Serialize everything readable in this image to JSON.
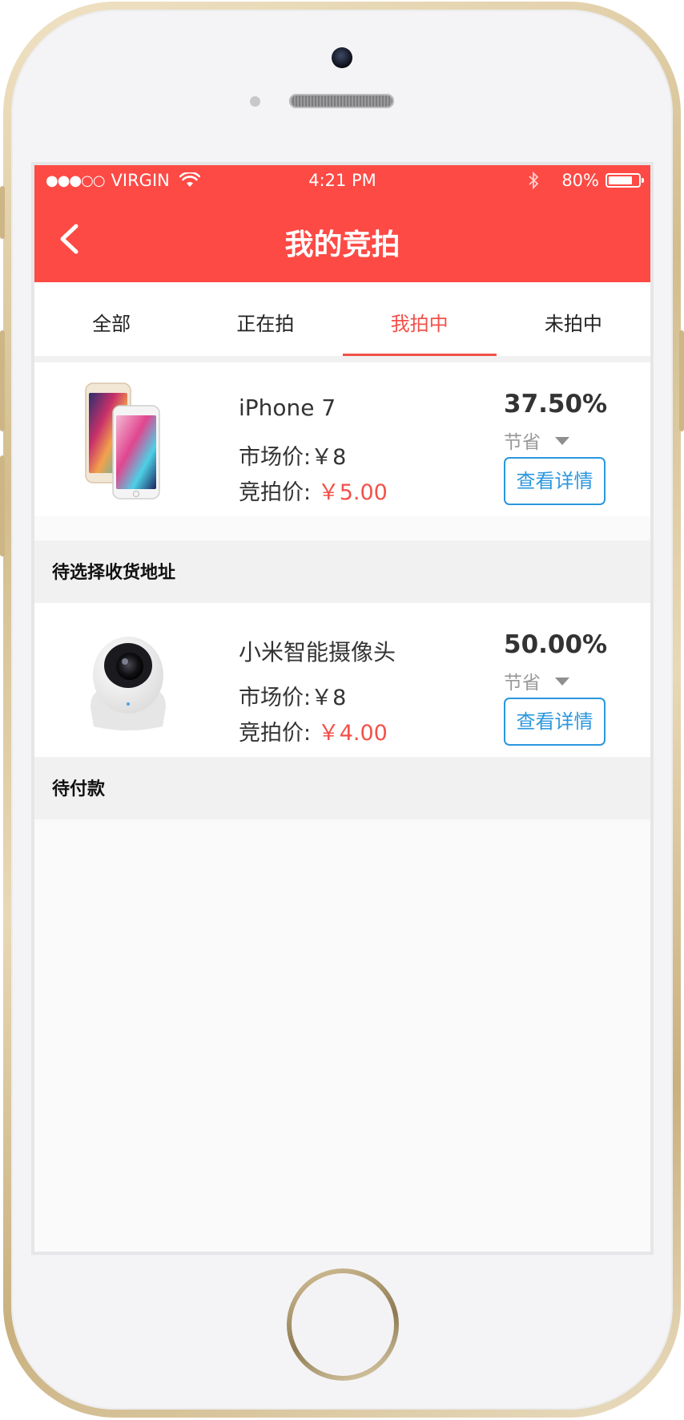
{
  "status_bar": {
    "carrier": "VIRGIN",
    "signal_dots": "●●●○○",
    "time": "4:21 PM",
    "battery": "80%",
    "battery_level": 0.8
  },
  "nav": {
    "title": "我的竞拍"
  },
  "tabs": [
    {
      "label": "全部",
      "active": false
    },
    {
      "label": "正在拍",
      "active": false
    },
    {
      "label": "我拍中",
      "active": true
    },
    {
      "label": "未拍中",
      "active": false
    }
  ],
  "items": [
    {
      "name": "iPhone 7",
      "market_price_label": "市场价:",
      "market_price": "￥8",
      "bid_price_label": "竞拍价:",
      "bid_price": "￥5.00",
      "save_percent": "37.50%",
      "save_label": "节省",
      "detail_button": "查看详情",
      "status": "待选择收货地址"
    },
    {
      "name": "小米智能摄像头",
      "market_price_label": "市场价:",
      "market_price": "￥8",
      "bid_price_label": "竞拍价:",
      "bid_price": "￥4.00",
      "save_percent": "50.00%",
      "save_label": "节省",
      "detail_button": "查看详情",
      "status": "待付款"
    }
  ],
  "colors": {
    "brand_red": "#fd4a45",
    "accent_red": "#f2514a",
    "link_blue": "#2b97de"
  }
}
